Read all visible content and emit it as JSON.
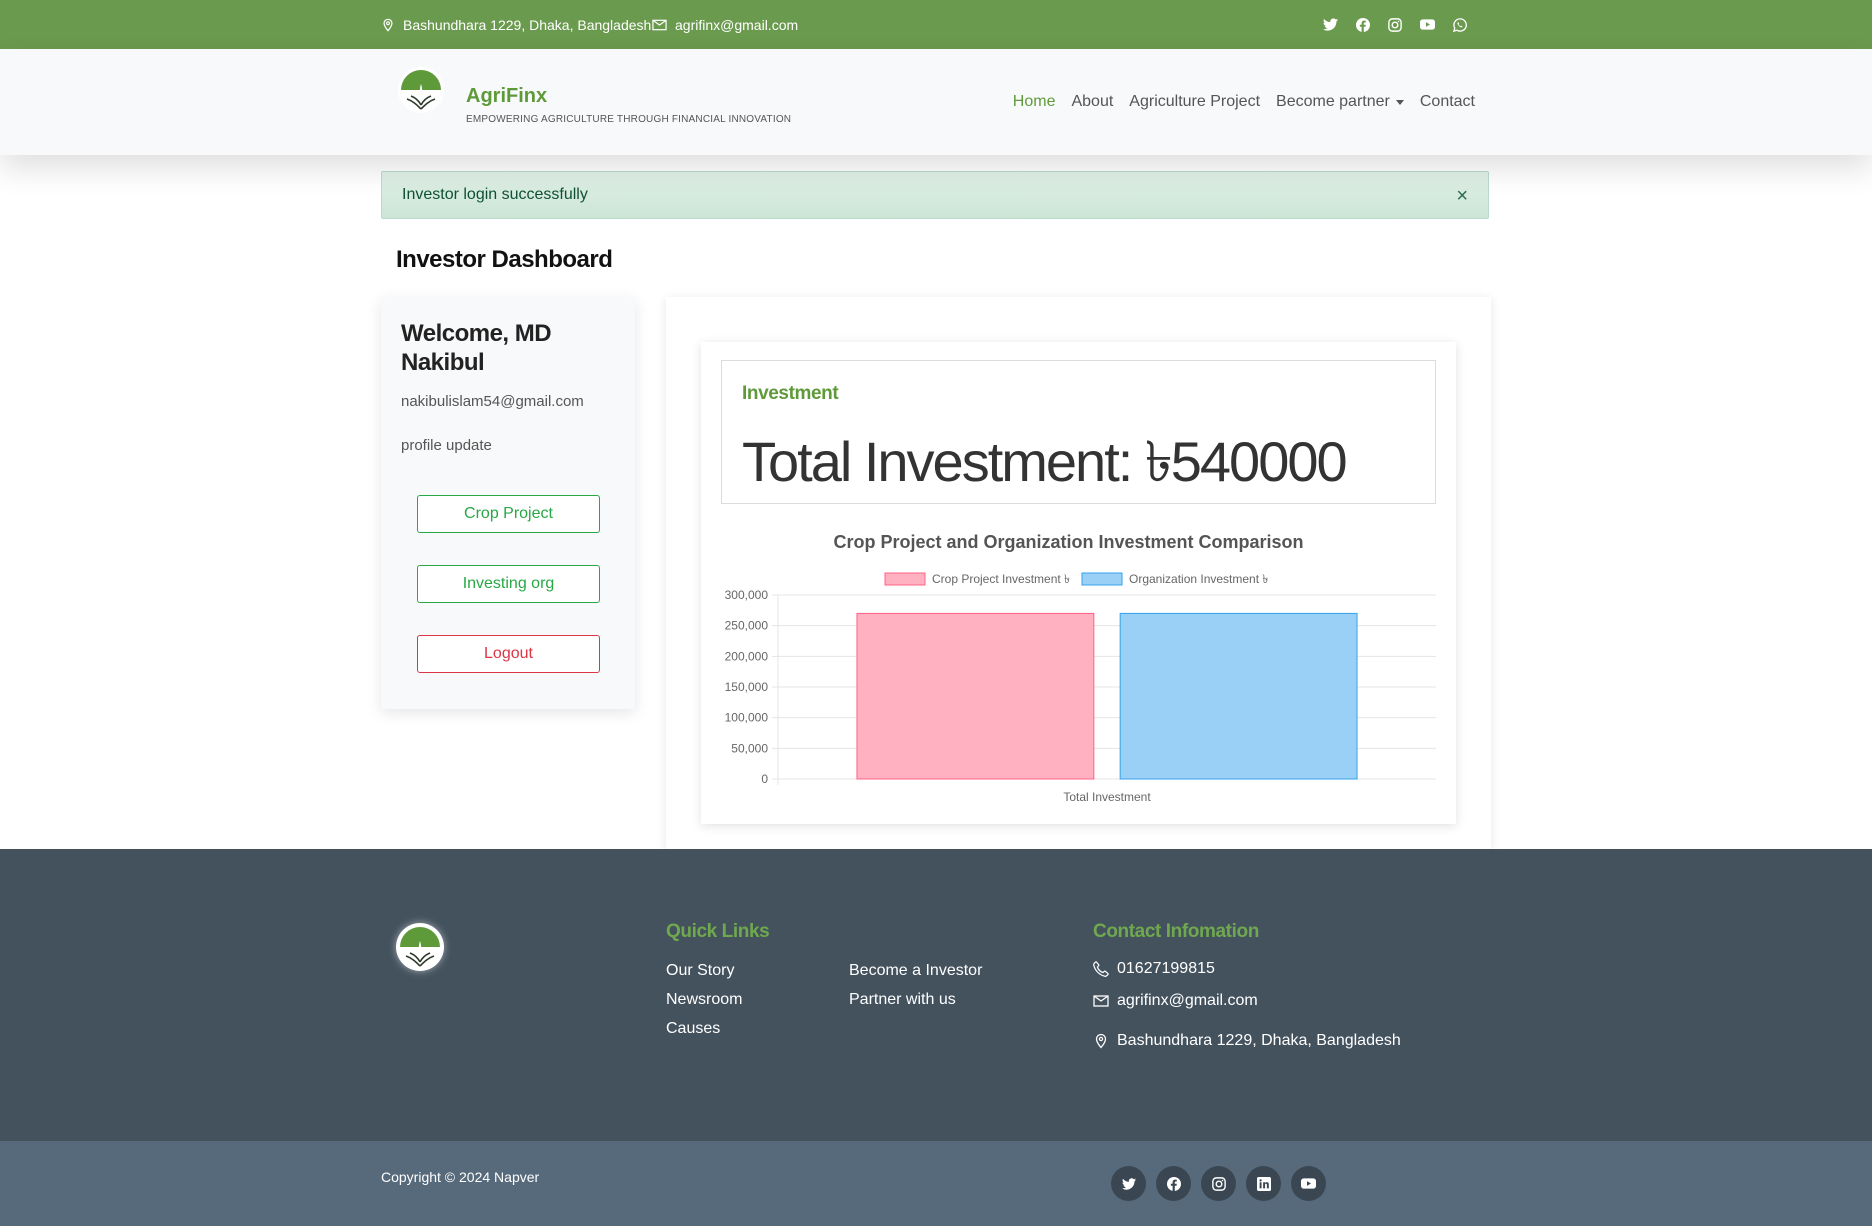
{
  "topbar": {
    "address": "Bashundhara 1229, Dhaka, Bangladesh",
    "email": "agrifinx@gmail.com",
    "socials": [
      "twitter-icon",
      "facebook-icon",
      "instagram-icon",
      "youtube-icon",
      "whatsapp-icon"
    ]
  },
  "brand": {
    "name": "AgriFinx",
    "tagline": "EMPOWERING AGRICULTURE THROUGH FINANCIAL INNOVATION"
  },
  "nav": {
    "home": "Home",
    "about": "About",
    "project": "Agriculture Project",
    "partner": "Become partner",
    "contact": "Contact"
  },
  "alert": {
    "message": "Investor login successfully",
    "close": "×"
  },
  "dashboard": {
    "title": "Investor Dashboard"
  },
  "profile": {
    "welcome": "Welcome, MD Nakibul",
    "email": "nakibulislam54@gmail.com",
    "update_link": "profile update",
    "crop_button": "Crop Project",
    "org_button": "Investing org",
    "logout_button": "Logout"
  },
  "investment": {
    "label": "Investment",
    "total": "Total Investment: ৳540000"
  },
  "chart_data": {
    "type": "bar",
    "title": "Crop Project and Organization Investment Comparison",
    "categories": [
      "Total Investment"
    ],
    "series": [
      {
        "name": "Crop Project Investment ৳",
        "values": [
          270000
        ],
        "color": "#ffb1c1",
        "border": "#ff6384"
      },
      {
        "name": "Organization Investment ৳",
        "values": [
          270000
        ],
        "color": "#9ad0f5",
        "border": "#36a2eb"
      }
    ],
    "ylim": [
      0,
      300000
    ],
    "yticks": [
      "300,000",
      "250,000",
      "200,000",
      "150,000",
      "100,000",
      "50,000",
      "0"
    ],
    "legend": "top",
    "grid": true
  },
  "footer": {
    "quick_links_title": "Quick Links",
    "links_col1": [
      "Our Story",
      "Newsroom",
      "Causes"
    ],
    "links_col2": [
      "Become a Investor",
      "Partner with us"
    ],
    "contact_title": "Contact Infomation",
    "phone": "01627199815",
    "email": "agrifinx@gmail.com",
    "address": "Bashundhara 1229, Dhaka, Bangladesh"
  },
  "bottom": {
    "copyright": "Copyright © 2024 Napver",
    "socials": [
      "twitter-icon",
      "facebook-icon",
      "instagram-icon",
      "linkedin-icon",
      "youtube-icon"
    ]
  },
  "colors": {
    "topbar": "#6a9a4d",
    "brand": "#5f9a3a",
    "footer": "#44525e",
    "bottom": "#576a7b"
  }
}
